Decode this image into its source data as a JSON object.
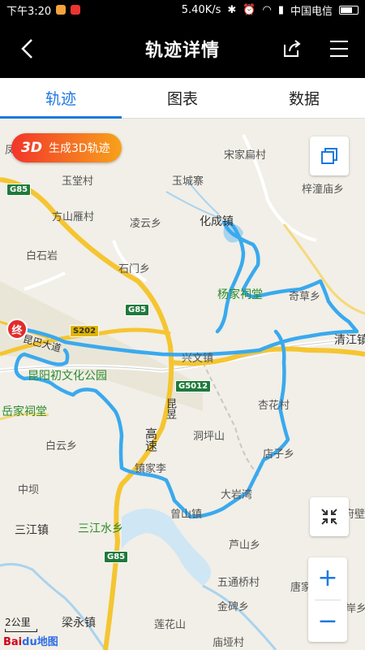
{
  "status": {
    "time": "下午3:20",
    "speed": "5.40K/s",
    "carrier": "中国电信"
  },
  "header": {
    "title": "轨迹详情"
  },
  "tabs": [
    "轨迹",
    "图表",
    "数据"
  ],
  "map": {
    "gen3d": {
      "prefix": "3D",
      "label": "生成3D轨迹"
    },
    "end_marker": "终",
    "scale": "2公里",
    "logo_a": "Bai",
    "logo_b": "du地图",
    "labels": {
      "feng": "凤",
      "songjia": "宋家扁村",
      "yutang": "玉堂村",
      "yucheng": "玉城寨",
      "zhangtan": "梓潼庙乡",
      "fangshan": "方山雁村",
      "lingyun": "凌云乡",
      "huacheng": "化成镇",
      "baishiyan": "白石岩",
      "shimen": "石门乡",
      "yangjiaci": "杨家祠堂",
      "qicao": "奇草乡",
      "qingjiang": "清江镇",
      "xingwen": "兴文镇",
      "kunyang": "昆阳初文化公园",
      "yuejia": "岳家祠堂",
      "xinghua": "杏花村",
      "dongping": "洞坪山",
      "baiyun": "白云乡",
      "zhenjiali": "镇家李",
      "dianzi": "店子乡",
      "zhongxiang": "中坝",
      "dayan": "大岩湾",
      "sanjiang": "三江镇",
      "sanjiangshui": "三江水乡",
      "caoshan": "曾山镇",
      "lushan": "芦山乡",
      "fubi": "府壁",
      "wutong": "五通桥村",
      "tangjia": "唐家",
      "jinbei": "金碑乡",
      "liangyong": "梁永镇",
      "lianhua": "莲花山",
      "miaoya": "庙垭村",
      "anxiang": "岸乡",
      "gaosu": "高速",
      "kunbei": "昆巴大道",
      "kunyu": "昆昱"
    },
    "shields": [
      "G85",
      "G85",
      "S202",
      "G5012",
      "G85"
    ]
  },
  "colors": {
    "accent": "#1f78e0",
    "route": "#3aa9ee"
  }
}
